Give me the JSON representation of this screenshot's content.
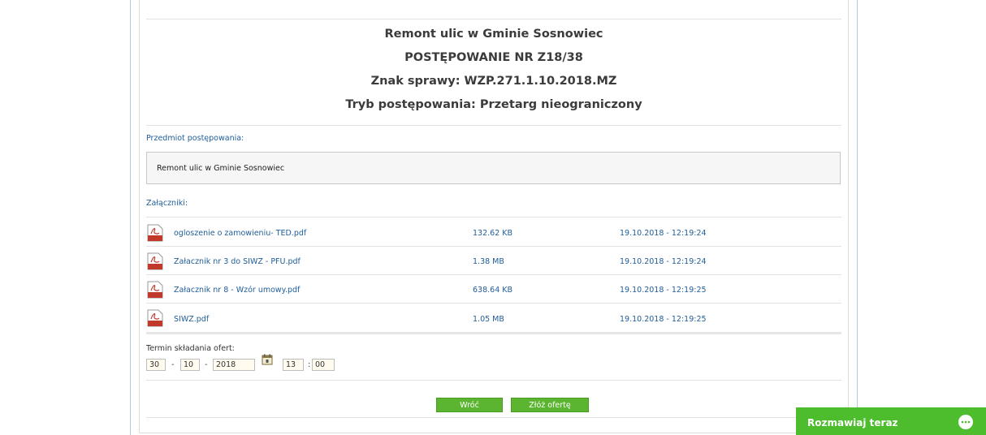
{
  "header": {
    "title": "Remont ulic w Gminie Sosnowiec",
    "proceeding_no": "POSTĘPOWANIE NR Z18/38",
    "case_ref": "Znak sprawy: WZP.271.1.10.2018.MZ",
    "mode": "Tryb postępowania: Przetarg nieograniczony"
  },
  "subject": {
    "label": "Przedmiot postępowania:",
    "value": "Remont ulic w Gminie Sosnowiec"
  },
  "attachments": {
    "label": "Załączniki:",
    "files": [
      {
        "name": "ogloszenie o zamowieniu- TED.pdf",
        "size": "132.62 KB",
        "date": "19.10.2018 - 12:19:24"
      },
      {
        "name": "Załacznik nr 3 do SIWZ - PFU.pdf",
        "size": "1.38 MB",
        "date": "19.10.2018 - 12:19:24"
      },
      {
        "name": "Załacznik nr 8 - Wzór umowy.pdf",
        "size": "638.64 KB",
        "date": "19.10.2018 - 12:19:25"
      },
      {
        "name": "SIWZ.pdf",
        "size": "1.05 MB",
        "date": "19.10.2018 - 12:19:25"
      }
    ]
  },
  "deadline": {
    "label": "Termin składania ofert:",
    "day": "30",
    "month": "10",
    "year": "2018",
    "hour": "13",
    "minute": "00",
    "date_sep": "-",
    "time_sep": ":"
  },
  "actions": {
    "back": "Wróć",
    "submit": "Złóż ofertę"
  },
  "chat": {
    "label": "Rozmawiaj teraz"
  },
  "colors": {
    "link": "#1f5d99",
    "button": "#5cb531",
    "chat": "#4dbd2e"
  }
}
